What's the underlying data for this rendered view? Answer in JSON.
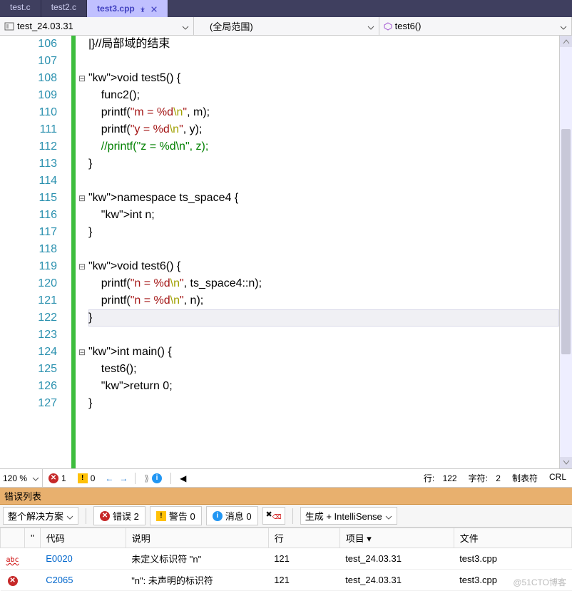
{
  "tabs": [
    {
      "label": "test.c"
    },
    {
      "label": "test2.c"
    },
    {
      "label": "test3.cpp",
      "active": true
    }
  ],
  "nav": {
    "project": "test_24.03.31",
    "scope": "(全局范围)",
    "member": "test6()"
  },
  "code": {
    "first_line": 106,
    "highlight_line": 122,
    "lines": [
      {
        "n": 106,
        "fold": "",
        "raw": "|}//局部域的结束"
      },
      {
        "n": 107,
        "fold": "",
        "raw": ""
      },
      {
        "n": 108,
        "fold": "⊟",
        "raw": "void test5() {"
      },
      {
        "n": 109,
        "fold": "",
        "raw": "    func2();"
      },
      {
        "n": 110,
        "fold": "",
        "raw": "    printf(\"m = %d\\n\", m);"
      },
      {
        "n": 111,
        "fold": "",
        "raw": "    printf(\"y = %d\\n\", y);"
      },
      {
        "n": 112,
        "fold": "",
        "raw": "    //printf(\"z = %d\\n\", z);"
      },
      {
        "n": 113,
        "fold": "",
        "raw": "}"
      },
      {
        "n": 114,
        "fold": "",
        "raw": ""
      },
      {
        "n": 115,
        "fold": "⊟",
        "raw": "namespace ts_space4 {"
      },
      {
        "n": 116,
        "fold": "",
        "raw": "    int n;"
      },
      {
        "n": 117,
        "fold": "",
        "raw": "}"
      },
      {
        "n": 118,
        "fold": "",
        "raw": ""
      },
      {
        "n": 119,
        "fold": "⊟",
        "raw": "void test6() {"
      },
      {
        "n": 120,
        "fold": "",
        "raw": "    printf(\"n = %d\\n\", ts_space4::n);"
      },
      {
        "n": 121,
        "fold": "",
        "raw": "    printf(\"n = %d\\n\", n);"
      },
      {
        "n": 122,
        "fold": "",
        "raw": "}"
      },
      {
        "n": 123,
        "fold": "",
        "raw": ""
      },
      {
        "n": 124,
        "fold": "⊟",
        "raw": "int main() {"
      },
      {
        "n": 125,
        "fold": "",
        "raw": "    test6();"
      },
      {
        "n": 126,
        "fold": "",
        "raw": "    return 0;"
      },
      {
        "n": 127,
        "fold": "",
        "raw": "}"
      }
    ]
  },
  "status": {
    "zoom": "120 %",
    "error_count": "1",
    "warning_count": "0",
    "line_label": "行:",
    "line": "122",
    "char_label": "字符:",
    "char": "2",
    "tabs_label": "制表符",
    "crlf": "CRL"
  },
  "errorlist": {
    "title": "错误列表",
    "scope": "整个解决方案",
    "btn_err": "错误 2",
    "btn_warn": "警告 0",
    "btn_info": "消息 0",
    "source": "生成 + IntelliSense",
    "cols": {
      "code": "代码",
      "desc": "说明",
      "line": "行",
      "project": "项目 ▾",
      "file": "文件"
    },
    "rows": [
      {
        "icon": "abc",
        "code": "E0020",
        "desc": "未定义标识符 \"n\"",
        "line": "121",
        "project": "test_24.03.31",
        "file": "test3.cpp"
      },
      {
        "icon": "err",
        "code": "C2065",
        "desc": "\"n\": 未声明的标识符",
        "line": "121",
        "project": "test_24.03.31",
        "file": "test3.cpp"
      }
    ]
  },
  "watermark": "@51CTO博客"
}
